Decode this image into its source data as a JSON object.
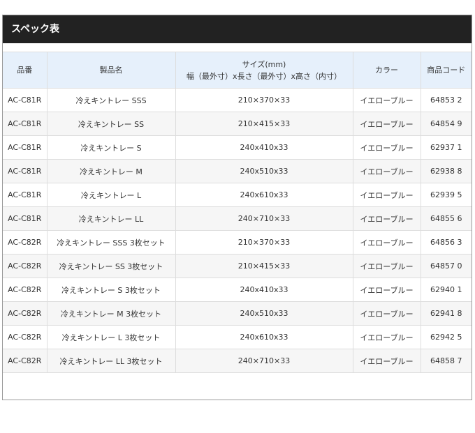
{
  "page": {
    "title": "スペック表"
  },
  "table": {
    "headers": {
      "code": "品番",
      "name": "製品名",
      "size_line1": "サイズ(mm)",
      "size_line2": "幅（最外寸）x長さ（最外寸）x高さ（内寸）",
      "color": "カラー",
      "product_code": "商品コード"
    },
    "rows": [
      {
        "code": "AC-C81R",
        "name": "冷えキントレー SSS",
        "size": "210×370×33",
        "color": "イエローブルー",
        "product_code": "64853 2"
      },
      {
        "code": "AC-C81R",
        "name": "冷えキントレー SS",
        "size": "210×415×33",
        "color": "イエローブルー",
        "product_code": "64854 9"
      },
      {
        "code": "AC-C81R",
        "name": "冷えキントレー S",
        "size": "240x410x33",
        "color": "イエローブルー",
        "product_code": "62937 1"
      },
      {
        "code": "AC-C81R",
        "name": "冷えキントレー M",
        "size": "240x510x33",
        "color": "イエローブルー",
        "product_code": "62938 8"
      },
      {
        "code": "AC-C81R",
        "name": "冷えキントレー L",
        "size": "240x610x33",
        "color": "イエローブルー",
        "product_code": "62939 5"
      },
      {
        "code": "AC-C81R",
        "name": "冷えキントレー LL",
        "size": "240×710×33",
        "color": "イエローブルー",
        "product_code": "64855 6"
      },
      {
        "code": "AC-C82R",
        "name": "冷えキントレー SSS 3枚セット",
        "size": "210×370×33",
        "color": "イエローブルー",
        "product_code": "64856 3"
      },
      {
        "code": "AC-C82R",
        "name": "冷えキントレー SS 3枚セット",
        "size": "210×415×33",
        "color": "イエローブルー",
        "product_code": "64857 0"
      },
      {
        "code": "AC-C82R",
        "name": "冷えキントレー S 3枚セット",
        "size": "240x410x33",
        "color": "イエローブルー",
        "product_code": "62940 1"
      },
      {
        "code": "AC-C82R",
        "name": "冷えキントレー M 3枚セット",
        "size": "240x510x33",
        "color": "イエローブルー",
        "product_code": "62941 8"
      },
      {
        "code": "AC-C82R",
        "name": "冷えキントレー L 3枚セット",
        "size": "240x610x33",
        "color": "イエローブルー",
        "product_code": "62942 5"
      },
      {
        "code": "AC-C82R",
        "name": "冷えキントレー LL 3枚セット",
        "size": "240×710×33",
        "color": "イエローブルー",
        "product_code": "64858 7"
      }
    ]
  },
  "colors": {
    "title_bar": "#222222",
    "header_bg": "#e6f0fb",
    "row_alt_bg": "#f6f6f6"
  }
}
